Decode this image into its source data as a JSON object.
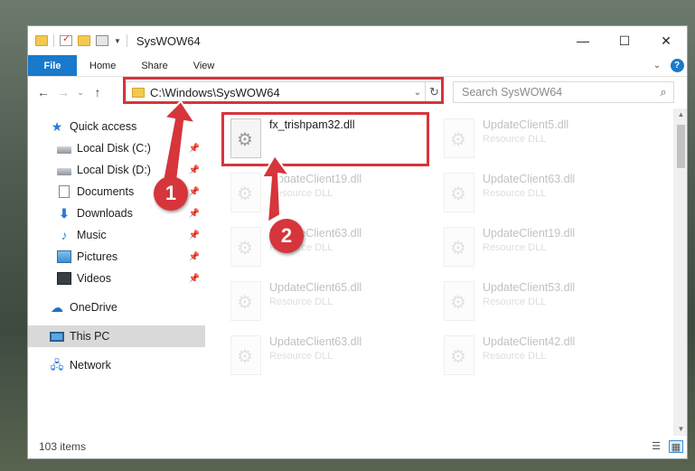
{
  "window": {
    "title": "SysWOW64",
    "minimize": "—",
    "maximize": "☐",
    "close": "✕"
  },
  "ribbon": {
    "tabs": [
      "File",
      "Home",
      "Share",
      "View"
    ],
    "expand_chevron": "⌄",
    "help": "?"
  },
  "navigation": {
    "back": "←",
    "forward": "→",
    "recent": "⌄",
    "up": "↑",
    "address": "C:\\Windows\\SysWOW64",
    "address_dropdown": "⌄",
    "refresh": "↻",
    "search_placeholder": "Search SysWOW64",
    "search_icon": "⌕"
  },
  "sidebar": {
    "quick_access": "Quick access",
    "items": [
      {
        "label": "Local Disk (C:)",
        "icon": "disk-icon"
      },
      {
        "label": "Local Disk (D:)",
        "icon": "disk-icon"
      },
      {
        "label": "Documents",
        "icon": "documents-icon"
      },
      {
        "label": "Downloads",
        "icon": "downloads-icon"
      },
      {
        "label": "Music",
        "icon": "music-icon"
      },
      {
        "label": "Pictures",
        "icon": "pictures-icon"
      },
      {
        "label": "Videos",
        "icon": "videos-icon"
      }
    ],
    "onedrive": "OneDrive",
    "this_pc": "This PC",
    "network": "Network",
    "pin_glyph": "📌"
  },
  "files": [
    {
      "name": "fx_trishpam32.dll",
      "type": "",
      "highlighted": true
    },
    {
      "name": "UpdateClient5.dll",
      "type": "Resource DLL"
    },
    {
      "name": "UpdateClient19.dll",
      "type": "Resource DLL"
    },
    {
      "name": "UpdateClient63.dll",
      "type": "Resource DLL"
    },
    {
      "name": "UpdateClient63.dll",
      "type": "Resource DLL"
    },
    {
      "name": "UpdateClient19.dll",
      "type": "Resource DLL"
    },
    {
      "name": "UpdateClient65.dll",
      "type": "Resource DLL"
    },
    {
      "name": "UpdateClient53.dll",
      "type": "Resource DLL"
    },
    {
      "name": "UpdateClient63.dll",
      "type": "Resource DLL"
    },
    {
      "name": "UpdateClient42.dll",
      "type": "Resource DLL"
    }
  ],
  "status": {
    "item_count": "103 items",
    "details_view": "☰",
    "tiles_view": "▦"
  },
  "callouts": [
    "1",
    "2"
  ],
  "colors": {
    "accent": "#1979ca",
    "highlight": "#d6353b",
    "selection": "#d9d9d9"
  }
}
